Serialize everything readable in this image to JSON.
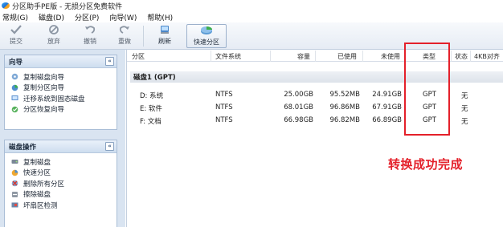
{
  "window": {
    "title": "分区助手PE版 - 无损分区免费软件"
  },
  "menu": [
    "常规(G)",
    "磁盘(D)",
    "分区(P)",
    "向导(W)",
    "帮助(H)"
  ],
  "toolbar": {
    "commit": "提交",
    "discard": "放弃",
    "undo": "撤销",
    "redo": "重做",
    "refresh": "刷新",
    "quick_partition": "快速分区"
  },
  "sidebar": {
    "wizard": {
      "title": "向导",
      "collapse": "«",
      "items": [
        "复制磁盘向导",
        "复制分区向导",
        "迁移系统到固态磁盘",
        "分区恢复向导"
      ]
    },
    "disk_ops": {
      "title": "磁盘操作",
      "collapse": "«",
      "items": [
        "复制磁盘",
        "快速分区",
        "删除所有分区",
        "擦除磁盘",
        "坏扇区检测"
      ]
    }
  },
  "table": {
    "columns": [
      "分区",
      "文件系统",
      "容量",
      "已使用",
      "未使用",
      "类型",
      "状态",
      "4KB对齐"
    ],
    "disk_label": "磁盘1 (GPT)",
    "rows": [
      {
        "partition": "D: 系统",
        "fs": "NTFS",
        "capacity": "25.00GB",
        "used": "95.52MB",
        "free": "24.91GB",
        "type": "GPT",
        "status": "无"
      },
      {
        "partition": "E: 软件",
        "fs": "NTFS",
        "capacity": "68.01GB",
        "used": "96.86MB",
        "free": "67.91GB",
        "type": "GPT",
        "status": "无"
      },
      {
        "partition": "F: 文档",
        "fs": "NTFS",
        "capacity": "66.98GB",
        "used": "96.82MB",
        "free": "66.89GB",
        "type": "GPT",
        "status": "无"
      }
    ]
  },
  "annotation": {
    "text": "转换成功完成",
    "color": "#e4202a"
  }
}
